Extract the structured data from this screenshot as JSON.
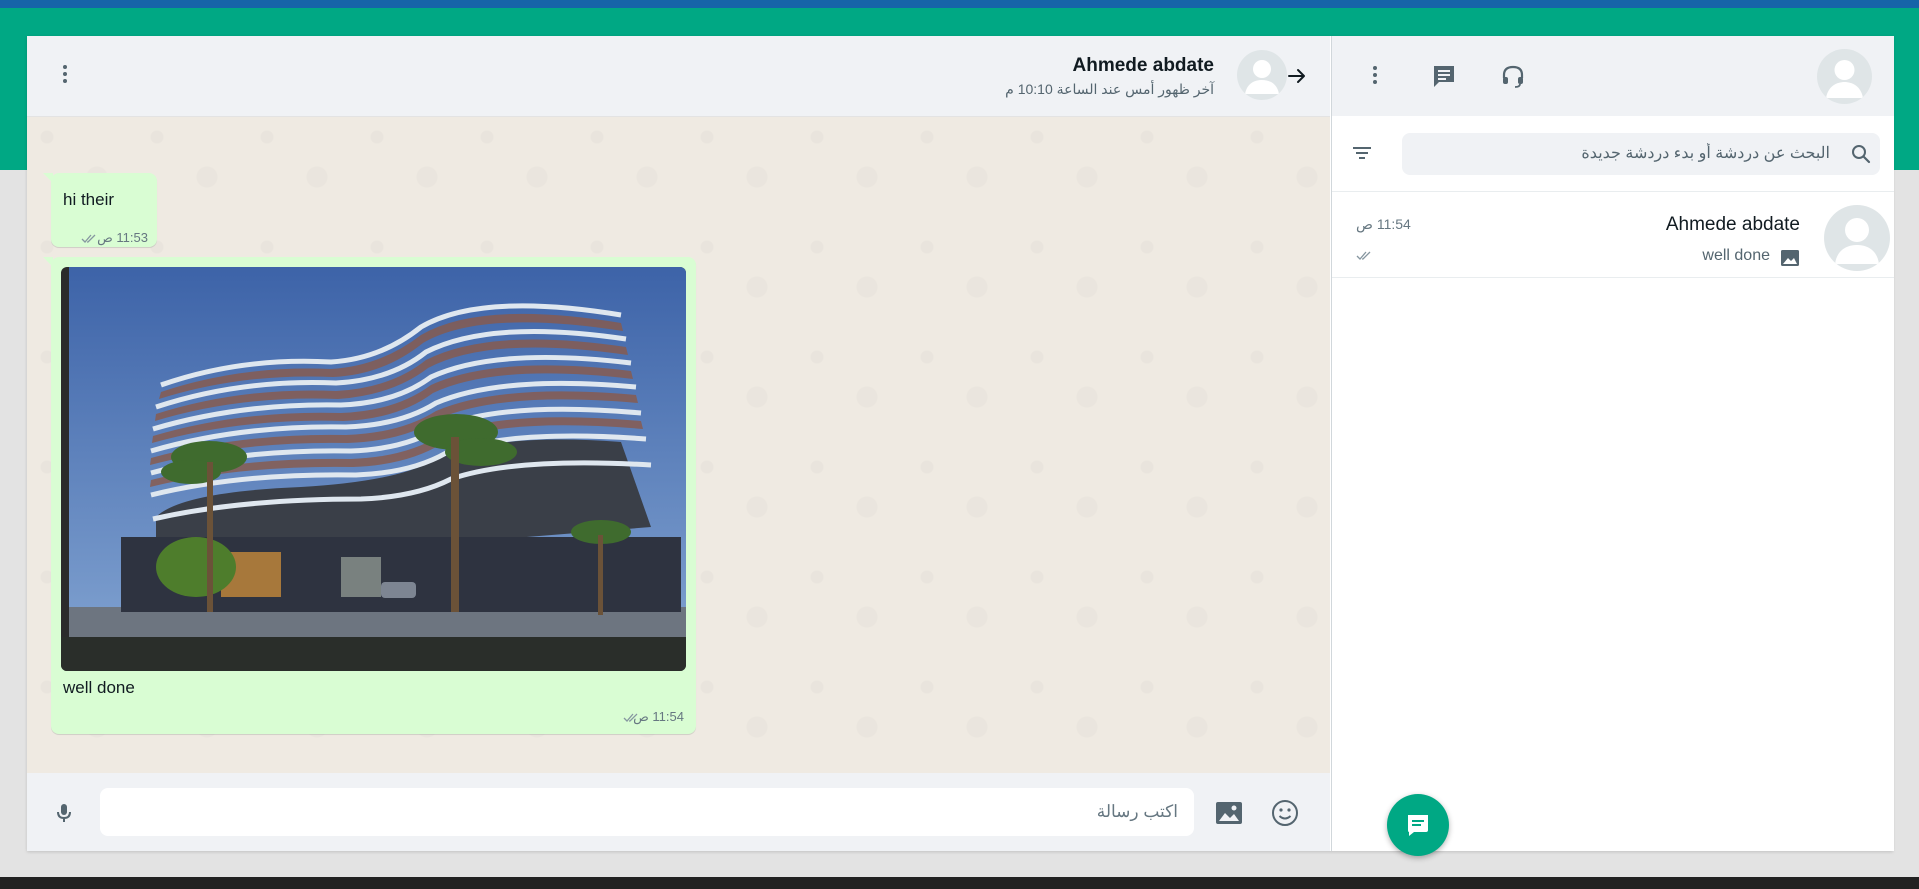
{
  "colors": {
    "accent": "#00a884",
    "outgoing_bubble": "#d9fdd3",
    "header_bg": "#f0f2f5",
    "chat_bg": "#efeae2"
  },
  "conversation": {
    "contact_name": "Ahmede abdate",
    "last_seen": "آخر ظهور أمس عند الساعة 10:10 م",
    "messages": [
      {
        "type": "text",
        "text": "hi their",
        "time": "11:53 ص",
        "status": "read-ticks-icon"
      },
      {
        "type": "image",
        "caption": "well done",
        "time": "11:54 ص",
        "status": "read-ticks-icon"
      }
    ]
  },
  "composer": {
    "placeholder": "اكتب رسالة"
  },
  "sidebar": {
    "search_placeholder": "البحث عن دردشة أو بدء دردشة جديدة",
    "chats": [
      {
        "name": "Ahmede abdate",
        "time": "11:54 ص",
        "preview": "well done",
        "preview_icon": "photo-icon",
        "status": "read-ticks-icon"
      }
    ]
  },
  "icons": {
    "chat_menu": "more-vertical-icon",
    "back": "arrow-right-icon",
    "mic": "microphone-icon",
    "attach": "image-icon",
    "emoji": "emoji-icon",
    "sidebar_menu": "more-vertical-icon",
    "new_chat": "chat-icon",
    "support": "headset-icon",
    "filter": "filter-icon",
    "search": "search-icon",
    "fab": "new-message-icon"
  }
}
